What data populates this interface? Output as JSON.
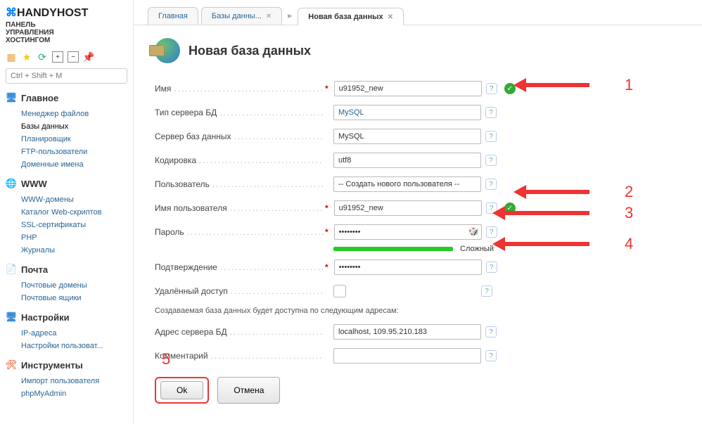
{
  "brand": {
    "name_plain": "HANDY",
    "name_accent": "HOST",
    "subtitle_l1": "ПАНЕЛЬ",
    "subtitle_l2": "УПРАВЛЕНИЯ",
    "subtitle_l3": "ХОСТИНГОМ"
  },
  "search": {
    "placeholder": "Ctrl + Shift + M"
  },
  "nav": {
    "main": {
      "title": "Главное",
      "items": [
        "Менеджер файлов",
        "Базы данных",
        "Планировщик",
        "FTP-пользователи",
        "Доменные имена"
      ],
      "active_index": 1
    },
    "www": {
      "title": "WWW",
      "items": [
        "WWW-домены",
        "Каталог Web-скриптов",
        "SSL-сертификаты",
        "PHP",
        "Журналы"
      ]
    },
    "mail": {
      "title": "Почта",
      "items": [
        "Почтовые домены",
        "Почтовые ящики"
      ]
    },
    "settings": {
      "title": "Настройки",
      "items": [
        "IP-адреса",
        "Настройки пользоват..."
      ]
    },
    "tools": {
      "title": "Инструменты",
      "items": [
        "Импорт пользователя",
        "phpMyAdmin"
      ]
    }
  },
  "tabs": {
    "t0": "Главная",
    "t1": "Базы данны...",
    "t2": "Новая база данных",
    "active": 2
  },
  "page": {
    "title": "Новая база данных"
  },
  "form": {
    "name": {
      "label": "Имя",
      "value": "u91952_new"
    },
    "dbtype": {
      "label": "Тип сервера БД",
      "value": "MySQL"
    },
    "dbserver": {
      "label": "Сервер баз данных",
      "value": "MySQL"
    },
    "charset": {
      "label": "Кодировка",
      "value": "utf8"
    },
    "user": {
      "label": "Пользователь",
      "value": "-- Создать нового пользователя --"
    },
    "username": {
      "label": "Имя пользователя",
      "value": "u91952_new"
    },
    "password": {
      "label": "Пароль",
      "strength": "Сложный"
    },
    "confirm": {
      "label": "Подтверждение"
    },
    "remote": {
      "label": "Удалённый доступ"
    },
    "note": "Создаваемая база данных будет доступна по следующим адресам:",
    "addr": {
      "label": "Адрес сервера БД",
      "value": "localhost, 109.95.210.183"
    },
    "comment": {
      "label": "Комментарий"
    }
  },
  "buttons": {
    "ok": "Ok",
    "cancel": "Отмена"
  },
  "annotations": {
    "a1": "1",
    "a2": "2",
    "a3": "3",
    "a4": "4",
    "a5": "5"
  }
}
